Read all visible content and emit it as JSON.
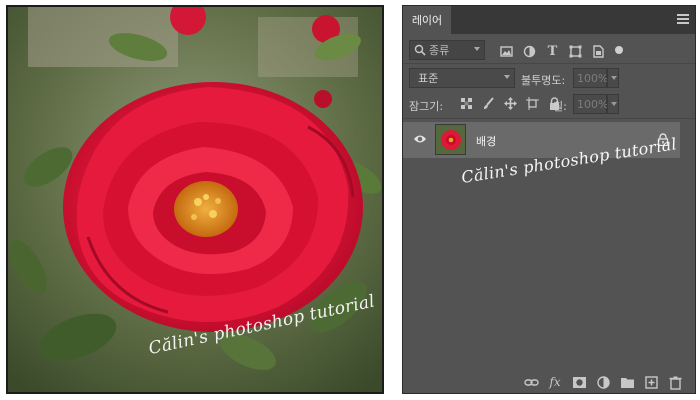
{
  "photo": {
    "watermark": "Călin's photoshop tutorial"
  },
  "layers_panel": {
    "tab_label": "레이어",
    "filter": {
      "kind_label": "종류",
      "icons": [
        "image-filter-icon",
        "adjustment-filter-icon",
        "type-filter-icon",
        "shape-filter-icon",
        "smart-object-filter-icon",
        "filter-toggle-icon"
      ]
    },
    "blend_mode": "표준",
    "opacity_label": "불투명도:",
    "opacity_value": "100%",
    "lock_label": "잠그기:",
    "lock_icons": [
      "lock-transparent-icon",
      "lock-paint-icon",
      "lock-move-icon",
      "lock-artboard-icon",
      "lock-all-icon"
    ],
    "fill_label": "칠:",
    "fill_value": "100%",
    "layers": [
      {
        "name": "배경",
        "visible": true,
        "locked": true
      }
    ],
    "watermark": "Călin's photoshop tutorial",
    "bottom_icons": [
      "link-icon",
      "fx-icon",
      "mask-icon",
      "adjustment-layer-icon",
      "folder-icon",
      "new-layer-icon",
      "trash-icon"
    ],
    "fx_label": "fx"
  },
  "colors": {
    "panel_bg": "#535353",
    "tabbar_bg": "#383838",
    "selected_layer_bg": "#6a6a6a",
    "rose": "#e01838"
  }
}
